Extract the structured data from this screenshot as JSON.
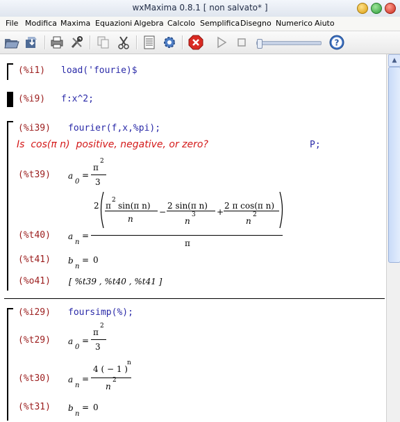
{
  "window": {
    "title": "wxMaxima 0.8.1 [ non salvato* ]",
    "buttons": {
      "minimize_color": "#e6b422",
      "maximize_color": "#3bb54a",
      "close_color": "#d83a2f"
    }
  },
  "menu": [
    "File",
    "Modifica",
    "Maxima",
    "Equazioni",
    "Algebra",
    "Calcolo",
    "Semplifica",
    "Disegno",
    "Numerico",
    "Aiuto"
  ],
  "toolbar": {
    "icons": [
      "open-icon",
      "save-icon",
      "print-icon",
      "preferences-icon",
      "copy-icon",
      "cut-icon",
      "select-all-icon",
      "configure-icon",
      "interrupt-icon",
      "play-animation-icon",
      "stop-animation-icon",
      "help-icon"
    ],
    "animation_slider": 0
  },
  "cells": {
    "c1": {
      "label": "(%i1)",
      "input": "load('fourie)$"
    },
    "c2": {
      "label": "(%i9)",
      "input": "f:x^2;"
    },
    "c3": {
      "label": "(%i39)",
      "input": "fourier(f,x,%pi);",
      "question": "Is  cos(π n)  positive, negative, or zero?",
      "answer": "P;",
      "t39": {
        "label": "(%t39)",
        "lhs": "a",
        "sub": "0",
        "eq": "=",
        "num": "π",
        "num_exp": "2",
        "den": "3"
      },
      "t40": {
        "label": "(%t40)",
        "lhs": "a",
        "sub": "n",
        "eq": "=",
        "coef": "2",
        "term1_num": "π",
        "term1_num_exp": "2",
        "term1_num_rest": "sin(π n)",
        "term1_den": "n",
        "minus": "−",
        "term2_num": "2 sin(π n)",
        "term2_den": "n",
        "term2_den_exp": "3",
        "plus": "+",
        "term3_num": "2 π cos(π n)",
        "term3_den": "n",
        "term3_den_exp": "2",
        "den": "π"
      },
      "t41": {
        "label": "(%t41)",
        "lhs": "b",
        "sub": "n",
        "eq": "=",
        "rhs": "0"
      },
      "o41": {
        "label": "(%o41)",
        "value": "[ %t39 , %t40 , %t41 ]"
      }
    },
    "c4": {
      "label": "(%i29)",
      "input": "foursimp(%);",
      "t29": {
        "label": "(%t29)",
        "lhs": "a",
        "sub": "0",
        "eq": "=",
        "num": "π",
        "num_exp": "2",
        "den": "3"
      },
      "t30": {
        "label": "(%t30)",
        "lhs": "a",
        "sub": "n",
        "eq": "=",
        "num": "4 ( − 1 )",
        "num_exp": "n",
        "den": "n",
        "den_exp": "2"
      },
      "t31": {
        "label": "(%t31)",
        "lhs": "b",
        "sub": "n",
        "eq": "=",
        "rhs": "0"
      }
    }
  }
}
